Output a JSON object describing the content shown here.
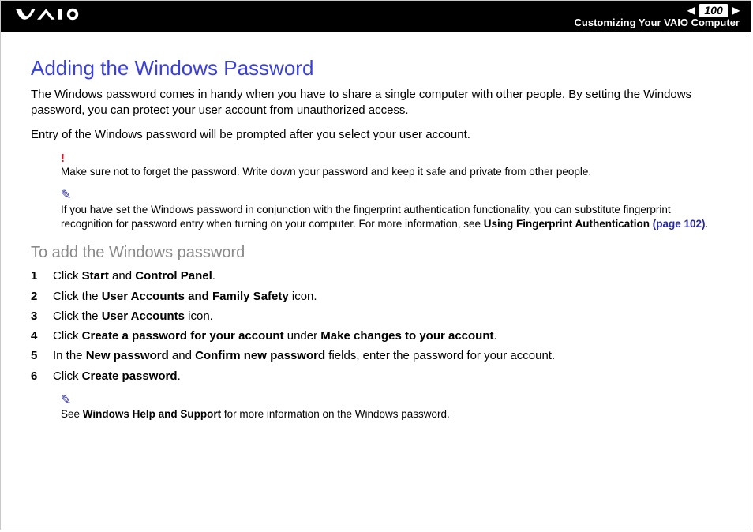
{
  "header": {
    "page_number": "100",
    "section": "Customizing Your VAIO Computer"
  },
  "title": "Adding the Windows Password",
  "intro1": "The Windows password comes in handy when you have to share a single computer with other people. By setting the Windows password, you can protect your user account from unauthorized access.",
  "intro2": "Entry of the Windows password will be prompted after you select your user account.",
  "warning": "Make sure not to forget the password. Write down your password and keep it safe and private from other people.",
  "note_fingerprint_pre": "If you have set the Windows password in conjunction with the fingerprint authentication functionality, you can substitute fingerprint recognition for password entry when turning on your computer. For more information, see ",
  "note_fingerprint_bold": "Using Fingerprint Authentication",
  "note_fingerprint_link": " (page 102)",
  "note_fingerprint_post": ".",
  "subhead": "To add the Windows password",
  "steps": {
    "s1_a": "Click ",
    "s1_b": "Start",
    "s1_c": " and ",
    "s1_d": "Control Panel",
    "s1_e": ".",
    "s2_a": "Click the ",
    "s2_b": "User Accounts and Family Safety",
    "s2_c": " icon.",
    "s3_a": "Click the ",
    "s3_b": "User Accounts",
    "s3_c": " icon.",
    "s4_a": "Click ",
    "s4_b": "Create a password for your account",
    "s4_c": " under ",
    "s4_d": "Make changes to your account",
    "s4_e": ".",
    "s5_a": "In the ",
    "s5_b": "New password",
    "s5_c": " and ",
    "s5_d": "Confirm new password",
    "s5_e": " fields, enter the password for your account.",
    "s6_a": "Click ",
    "s6_b": "Create password",
    "s6_c": "."
  },
  "note_help_a": "See ",
  "note_help_b": "Windows Help and Support",
  "note_help_c": " for more information on the Windows password."
}
